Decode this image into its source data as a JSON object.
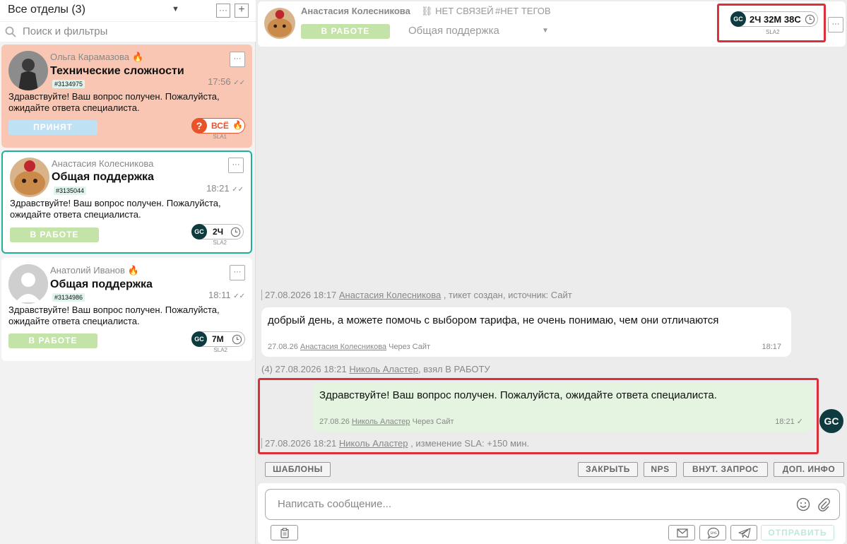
{
  "departments": {
    "title": "Все отделы (3)"
  },
  "search": {
    "placeholder": "Поиск и фильтры"
  },
  "tickets": [
    {
      "name": "Ольга Карамазова",
      "hot": true,
      "subject": "Технические сложности",
      "id": "#3134975",
      "time": "17:56",
      "message": "Здравствуйте! Ваш вопрос получен. Пожалуйста, ожидайте ответа специалиста.",
      "status": "ПРИНЯТ",
      "sla_value": "ВСЁ",
      "sla_label": "SLA1"
    },
    {
      "name": "Анастасия Колесникова",
      "hot": false,
      "subject": "Общая поддержка",
      "id": "#3135044",
      "time": "18:21",
      "message": "Здравствуйте! Ваш вопрос получен. Пожалуйста, ожидайте ответа специалиста.",
      "status": "В РАБОТЕ",
      "sla_value": "2Ч",
      "sla_label": "SLA2"
    },
    {
      "name": "Анатолий Иванов",
      "hot": true,
      "subject": "Общая поддержка",
      "id": "#3134986",
      "time": "18:11",
      "message": "Здравствуйте! Ваш вопрос получен. Пожалуйста, ожидайте ответа специалиста.",
      "status": "В РАБОТЕ",
      "sla_value": "7М",
      "sla_label": "SLA2"
    }
  ],
  "header": {
    "name": "Анастасия Колесникова",
    "links": "НЕТ СВЯЗЕЙ",
    "tags": "#НЕТ ТЕГОВ",
    "status": "В РАБОТЕ",
    "department": "Общая поддержка",
    "sla_value": "2Ч 32М 38С",
    "sla_label": "SLA2"
  },
  "brand": {
    "logo": "GC",
    "accent": "#1fb09a",
    "dark": "#0d3b40",
    "highlight": "#d9303a"
  },
  "chat": {
    "sys1": {
      "date": "27.08.2026 18:17",
      "user": "Анастасия Колесникова",
      "text": ", тикет создан, источник: Сайт"
    },
    "msg_in": {
      "text": "добрый день, а можете помочь с выбором тарифа, не очень понимаю, чем они отличаются",
      "date": "27.08.26",
      "author": "Анастасия Колесникова",
      "via": "Через Сайт",
      "time": "18:17"
    },
    "sys2": {
      "count": "(4)",
      "date": "27.08.2026 18:21",
      "user": "Николь Аластер",
      "text": ", взял В РАБОТУ"
    },
    "msg_out": {
      "text": "Здравствуйте! Ваш вопрос получен. Пожалуйста, ожидайте ответа специалиста.",
      "date": "27.08.26",
      "author": "Николь Аластер",
      "via": "Через Сайт",
      "time": "18:21"
    },
    "sys3": {
      "date": "27.08.2026 18:21",
      "user": "Николь Аластер",
      "text": ", изменение SLA: +150 мин."
    }
  },
  "toolbar": {
    "templates": "ШАБЛОНЫ",
    "close": "ЗАКРЫТЬ",
    "nps": "NPS",
    "internal": "ВНУТ. ЗАПРОС",
    "extra": "ДОП. ИНФО"
  },
  "composer": {
    "placeholder": "Написать сообщение...",
    "send": "ОТПРАВИТЬ"
  }
}
